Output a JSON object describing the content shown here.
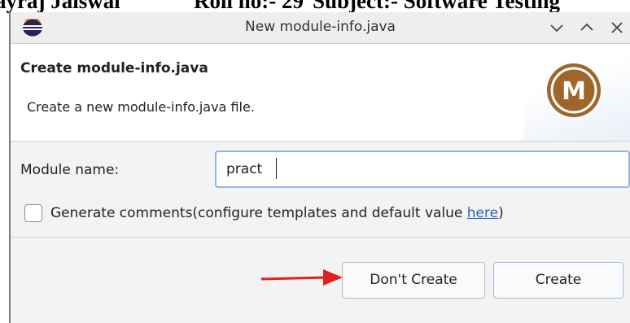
{
  "document": {
    "author": "ayraj Jaiswal",
    "roll": "Roll no:- 29",
    "subject": "Subject:- Software Testing"
  },
  "window": {
    "title": "New module-info.java"
  },
  "header": {
    "title": "Create module-info.java",
    "description": "Create a new module-info.java file.",
    "logo_letter": "M"
  },
  "form": {
    "module_name_label": "Module name:",
    "module_name_value": "pract",
    "generate_comments_checked": false,
    "generate_comments_label": "Generate comments(configure templates and default value ",
    "here_link": "here",
    "closing_paren": ")"
  },
  "buttons": {
    "dont_create": "Don't Create",
    "create": "Create"
  },
  "icons": {
    "app": "eclipse-icon",
    "minimize": "chevron-down-icon",
    "maximize": "chevron-up-icon",
    "close": "close-icon",
    "logo": "module-icon",
    "annotation": "red-arrow-icon"
  },
  "colors": {
    "module_logo": "#a0652a",
    "link": "#2a62c2",
    "arrow": "#e02020",
    "input_focus": "#8fb6e8"
  }
}
